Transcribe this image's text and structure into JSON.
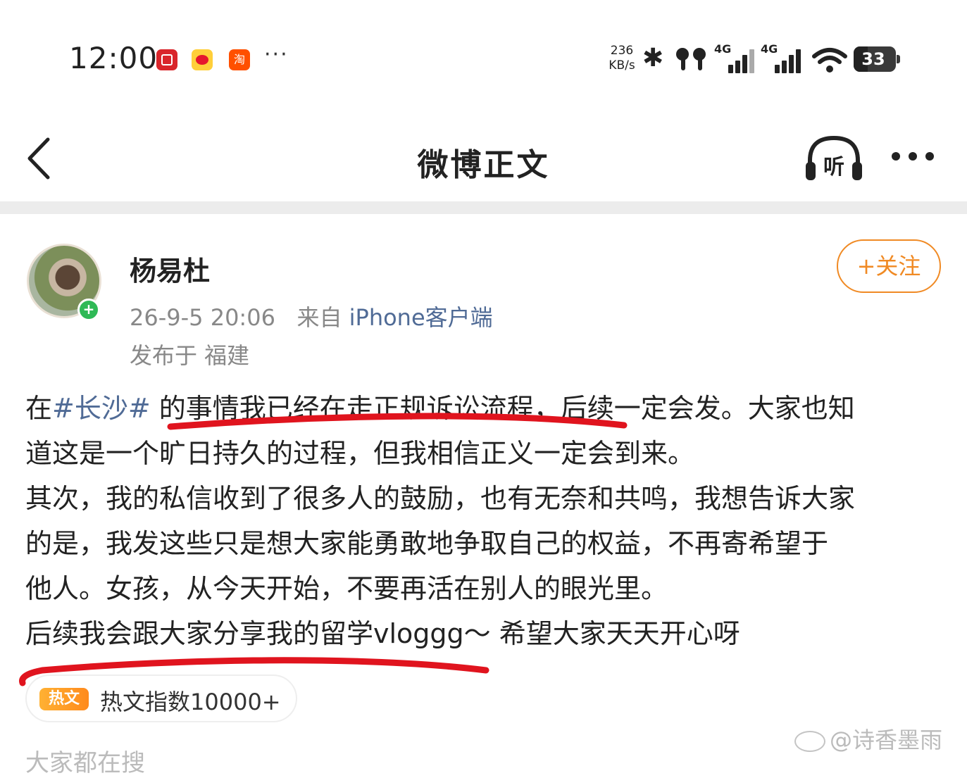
{
  "status_bar": {
    "time": "12:00",
    "app_icons": [
      "bank-app-icon",
      "weibo-icon",
      "taobao-icon"
    ],
    "taobao_glyph": "淘",
    "more": "···",
    "net_speed_value": "236",
    "net_speed_unit": "KB/s",
    "sim1_label": "4G",
    "sim2_label": "4G",
    "battery": "33",
    "battery_level_percent": 33
  },
  "header": {
    "title": "微博正文",
    "listen_label": "听"
  },
  "post": {
    "author": "杨易杜",
    "follow_label": "+关注",
    "timestamp": "26-9-5 20:06",
    "source_prefix": "来自",
    "source": "iPhone客户端",
    "location": "发布于 福建",
    "body_lines": [
      {
        "pre": "在",
        "tag": "#长沙#",
        "post": " 的事情我已经在走正规诉讼流程，后续一定会发。大家也知"
      },
      {
        "text": "道这是一个旷日持久的过程，但我相信正义一定会到来。"
      },
      {
        "text": "其次，我的私信收到了很多人的鼓励，也有无奈和共鸣，我想告诉大家"
      },
      {
        "text": "的是，我发这些只是想大家能勇敢地争取自己的权益，不再寄希望于"
      },
      {
        "text": "他人。女孩，从今天开始，不要再活在别人的眼光里。"
      },
      {
        "text": "后续我会跟大家分享我的留学vloggg～ 希望大家天天开心呀"
      }
    ],
    "hot_badge": "热文",
    "hot_index": "热文指数10000+"
  },
  "cut_off_text": "大家都在搜",
  "watermark": "@诗香墨雨",
  "colors": {
    "accent_orange": "#f08a24",
    "link_blue": "#506b96",
    "annotation_red": "#e0141e"
  }
}
